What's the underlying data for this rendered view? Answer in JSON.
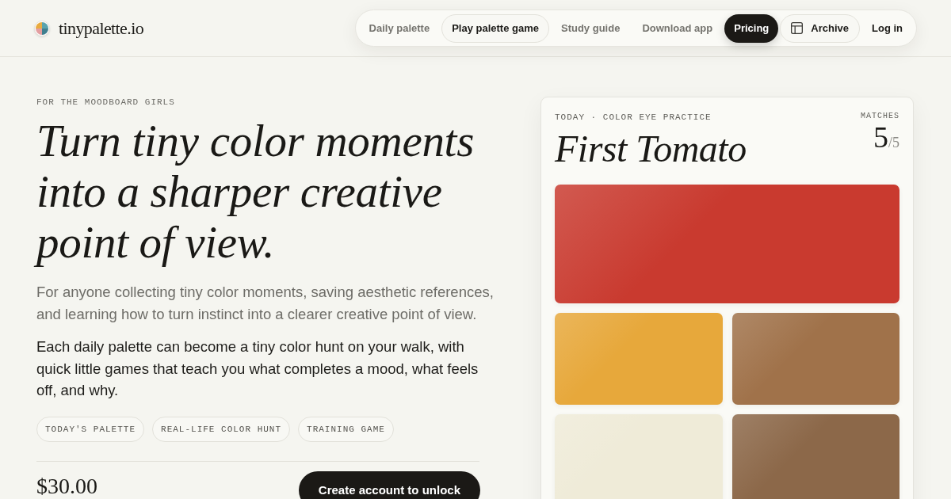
{
  "header": {
    "logo": {
      "text": "tinypalette.io"
    },
    "nav": [
      {
        "label": "Daily palette",
        "kind": "link"
      },
      {
        "label": "Play palette game",
        "kind": "outline"
      },
      {
        "label": "Study guide",
        "kind": "link"
      },
      {
        "label": "Download app",
        "kind": "link"
      },
      {
        "label": "Pricing",
        "kind": "primary"
      },
      {
        "label": "Archive",
        "kind": "outline-icon"
      },
      {
        "label": "Log in",
        "kind": "plain"
      }
    ]
  },
  "hero": {
    "eyebrow": "FOR THE MOODBOARD GIRLS",
    "headline": "Turn tiny color moments into a sharper creative point of view.",
    "intro": "For anyone collecting tiny color moments, saving aesthetic references, and learning how to turn instinct into a clearer creative point of view.",
    "body": "Each daily palette can become a tiny color hunt on your walk, with quick little games that teach you what completes a mood, what feels off, and why.",
    "tags": [
      "TODAY'S PALETTE",
      "REAL-LIFE COLOR HUNT",
      "TRAINING GAME"
    ],
    "price": "$30.00",
    "cta": "Create account to unlock"
  },
  "practice_card": {
    "eyebrow": "TODAY · COLOR EYE PRACTICE",
    "title": "First Tomato",
    "matches_label": "MATCHES",
    "matches_score": "5",
    "matches_total": "/5",
    "swatches": [
      {
        "color": "#c93a2f"
      },
      {
        "color": "#e7a83b"
      },
      {
        "color": "#a0724a"
      },
      {
        "color": "#efebd8"
      },
      {
        "color": "#8c6849"
      }
    ]
  }
}
